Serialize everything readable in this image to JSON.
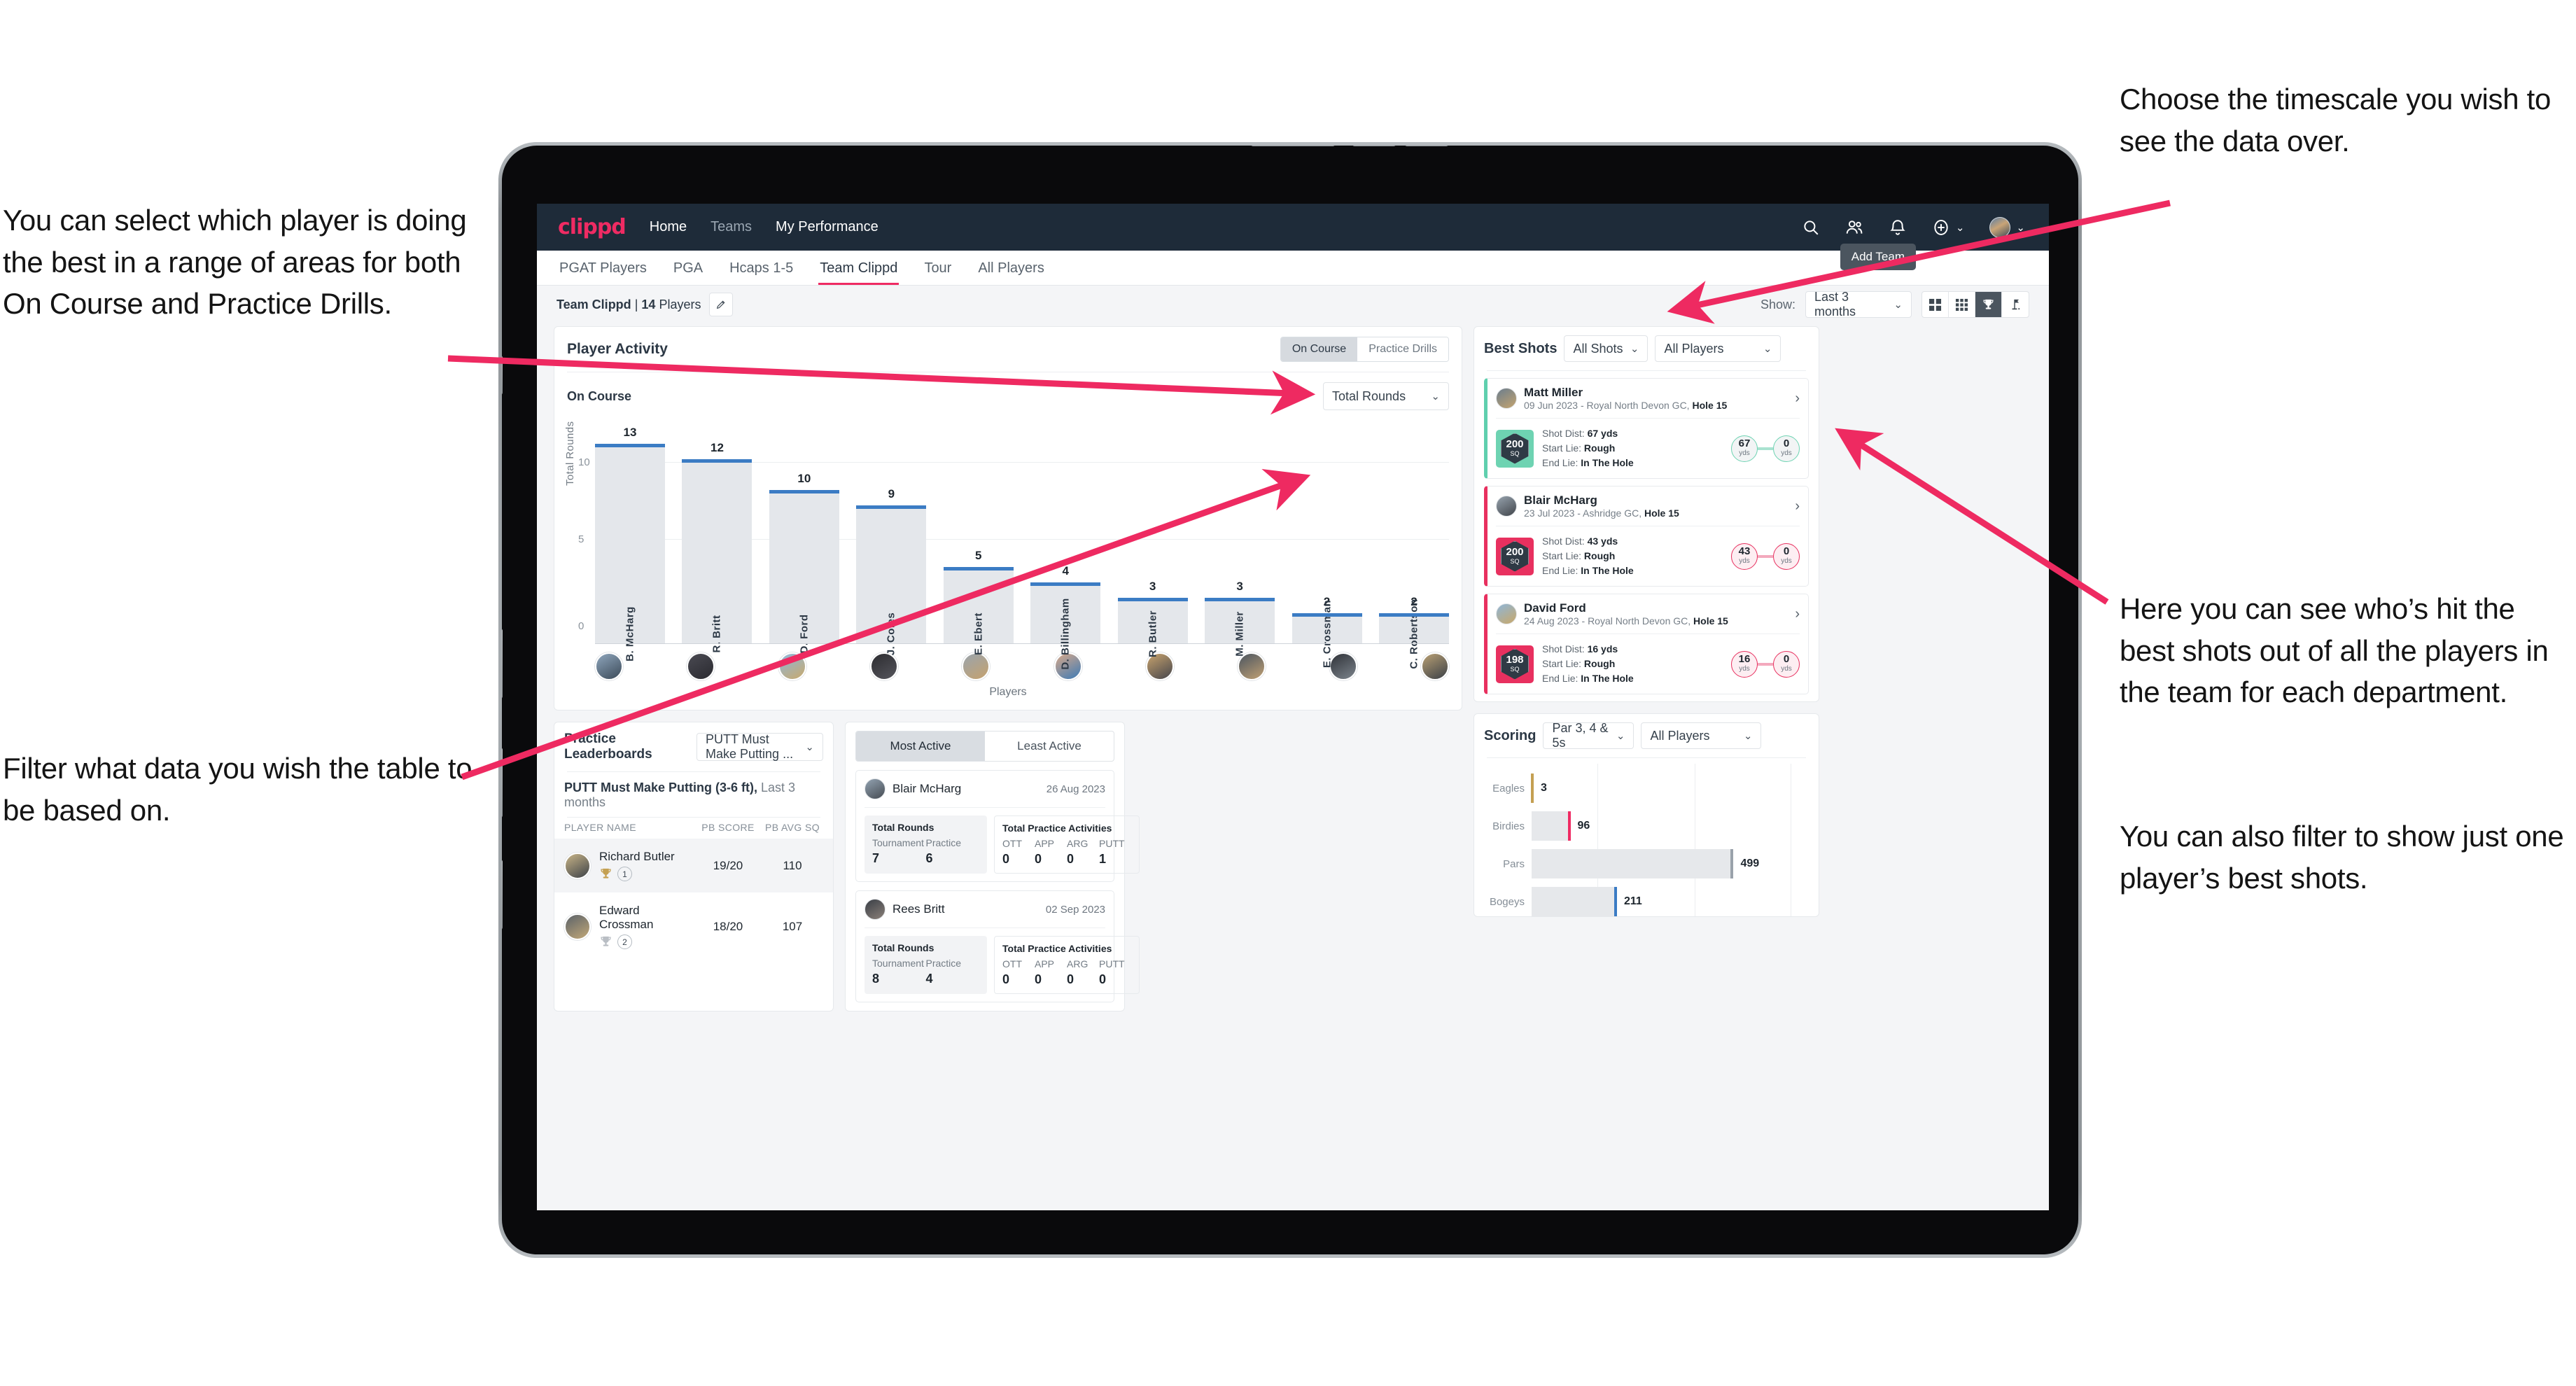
{
  "annotations": {
    "left_top": "You can select which player is doing the best in a range of areas for both On Course and Practice Drills.",
    "left_bottom": "Filter what data you wish the table to be based on.",
    "right_top": "Choose the timescale you wish to see the data over.",
    "right_middle": "Here you can see who’s hit the best shots out of all the players in the team for each department.",
    "right_bottom": "You can also filter to show just one player’s best shots."
  },
  "colors": {
    "brand_pink": "#ef2b63",
    "nav_dark": "#1e2b39",
    "bar_blue": "#3b7cc4",
    "teal": "#6ed3b2",
    "gold": "#c4a052",
    "annotation_arrow": "#ee2a61"
  },
  "topnav": {
    "logo": "clippd",
    "links": [
      {
        "label": "Home",
        "active": true
      },
      {
        "label": "Teams",
        "active": false
      },
      {
        "label": "My Performance",
        "active": true
      }
    ],
    "icons": [
      "search-icon",
      "people-icon",
      "bell-icon",
      "plus-circle-icon",
      "avatar"
    ]
  },
  "tabbar": {
    "tabs": [
      {
        "label": "PGAT Players",
        "active": false
      },
      {
        "label": "PGA",
        "active": false
      },
      {
        "label": "Hcaps 1-5",
        "active": false
      },
      {
        "label": "Team Clippd",
        "active": true
      },
      {
        "label": "Tour",
        "active": false
      },
      {
        "label": "All Players",
        "active": false
      }
    ],
    "tooltip": "Add Team"
  },
  "toolbar": {
    "team_name": "Team Clippd",
    "separator": "|",
    "player_count": "14",
    "players_word": "Players",
    "show_label": "Show:",
    "timescale_value": "Last 3 months",
    "view_icons": [
      "grid-large-icon",
      "grid-small-icon",
      "trophy-icon",
      "flag-icon"
    ],
    "active_view": "trophy-icon"
  },
  "player_activity": {
    "title": "Player Activity",
    "segments": [
      {
        "label": "On Course",
        "active": true
      },
      {
        "label": "Practice Drills",
        "active": false
      }
    ],
    "sub_label": "On Course",
    "metric_value": "Total Rounds",
    "x_axis_label": "Players"
  },
  "chart_data": {
    "type": "bar",
    "title": "Player Activity - On Course",
    "xlabel": "Players",
    "ylabel": "Total Rounds",
    "ylim": [
      0,
      14
    ],
    "yticks": [
      0,
      5,
      10
    ],
    "grid": true,
    "categories": [
      "B. McHarg",
      "R. Britt",
      "D. Ford",
      "J. Coles",
      "E. Ebert",
      "D. Billingham",
      "R. Butler",
      "M. Miller",
      "E. Crossman",
      "C. Robertson"
    ],
    "values": [
      13,
      12,
      10,
      9,
      5,
      4,
      3,
      3,
      2,
      2
    ]
  },
  "best_shots": {
    "title": "Best Shots",
    "shot_filter": "All Shots",
    "player_filter": "All Players",
    "cards": [
      {
        "name": "Matt Miller",
        "meta_prefix": "09 Jun 2023 - Royal North Devon GC,",
        "meta_hole": "Hole 15",
        "accent": "teal",
        "badge_value": "200",
        "badge_unit": "SQ",
        "shot_dist_label": "Shot Dist:",
        "shot_dist_value": "67 yds",
        "start_lie_label": "Start Lie:",
        "start_lie_value": "Rough",
        "end_lie_label": "End Lie:",
        "end_lie_value": "In The Hole",
        "from_value": "67",
        "from_unit": "yds",
        "to_value": "0",
        "to_unit": "yds"
      },
      {
        "name": "Blair McHarg",
        "meta_prefix": "23 Jul 2023 - Ashridge GC,",
        "meta_hole": "Hole 15",
        "accent": "pink",
        "badge_value": "200",
        "badge_unit": "SQ",
        "shot_dist_label": "Shot Dist:",
        "shot_dist_value": "43 yds",
        "start_lie_label": "Start Lie:",
        "start_lie_value": "Rough",
        "end_lie_label": "End Lie:",
        "end_lie_value": "In The Hole",
        "from_value": "43",
        "from_unit": "yds",
        "to_value": "0",
        "to_unit": "yds"
      },
      {
        "name": "David Ford",
        "meta_prefix": "24 Aug 2023 - Royal North Devon GC,",
        "meta_hole": "Hole 15",
        "accent": "pink",
        "badge_value": "198",
        "badge_unit": "SQ",
        "shot_dist_label": "Shot Dist:",
        "shot_dist_value": "16 yds",
        "start_lie_label": "Start Lie:",
        "start_lie_value": "Rough",
        "end_lie_label": "End Lie:",
        "end_lie_value": "In The Hole",
        "from_value": "16",
        "from_unit": "yds",
        "to_value": "0",
        "to_unit": "yds"
      }
    ]
  },
  "practice_leaderboards": {
    "title": "Practice Leaderboards",
    "drill_select": "PUTT Must Make Putting ...",
    "subtitle_bold": "PUTT Must Make Putting (3-6 ft),",
    "subtitle_light": "Last 3 months",
    "columns": [
      "PLAYER NAME",
      "PB SCORE",
      "PB AVG SQ"
    ],
    "rows": [
      {
        "name": "Richard Butler",
        "rank": "1",
        "trophy": "gold",
        "pb_score": "19/20",
        "pb_avg_sq": "110"
      },
      {
        "name": "Edward Crossman",
        "rank": "2",
        "trophy": "silver",
        "pb_score": "18/20",
        "pb_avg_sq": "107"
      }
    ]
  },
  "activity_panel": {
    "tabs": [
      {
        "label": "Most Active",
        "active": true
      },
      {
        "label": "Least Active",
        "active": false
      }
    ],
    "cards": [
      {
        "name": "Blair McHarg",
        "date": "26 Aug 2023",
        "rounds_title": "Total Rounds",
        "rounds": [
          {
            "key": "Tournament",
            "value": "7"
          },
          {
            "key": "Practice",
            "value": "6"
          }
        ],
        "practice_title": "Total Practice Activities",
        "practice": [
          {
            "key": "OTT",
            "value": "0"
          },
          {
            "key": "APP",
            "value": "0"
          },
          {
            "key": "ARG",
            "value": "0"
          },
          {
            "key": "PUTT",
            "value": "1"
          }
        ]
      },
      {
        "name": "Rees Britt",
        "date": "02 Sep 2023",
        "rounds_title": "Total Rounds",
        "rounds": [
          {
            "key": "Tournament",
            "value": "8"
          },
          {
            "key": "Practice",
            "value": "4"
          }
        ],
        "practice_title": "Total Practice Activities",
        "practice": [
          {
            "key": "OTT",
            "value": "0"
          },
          {
            "key": "APP",
            "value": "0"
          },
          {
            "key": "ARG",
            "value": "0"
          },
          {
            "key": "PUTT",
            "value": "0"
          }
        ]
      }
    ]
  },
  "scoring": {
    "title": "Scoring",
    "par_filter": "Par 3, 4 & 5s",
    "player_filter": "All Players",
    "chart": {
      "type": "bar",
      "orientation": "horizontal",
      "categories": [
        "Eagles",
        "Birdies",
        "Pars",
        "Bogeys"
      ],
      "values": [
        3,
        96,
        499,
        211
      ],
      "colors": [
        "#c4a052",
        "#ef2b63",
        "#9aa2ab",
        "#3b7cc4"
      ],
      "xmax": 640,
      "grid": true
    }
  }
}
